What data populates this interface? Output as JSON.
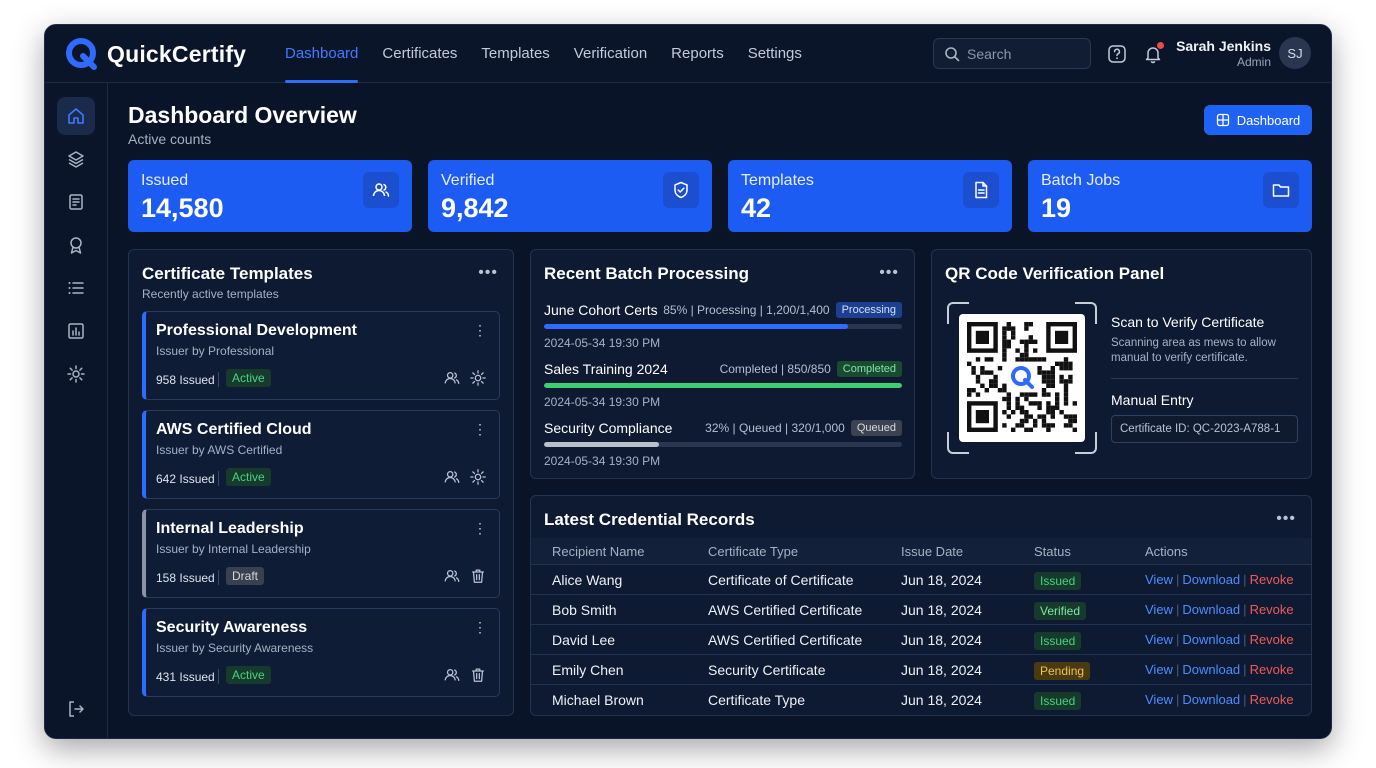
{
  "app": {
    "name": "QuickCertify"
  },
  "nav": {
    "items": [
      {
        "label": "Dashboard",
        "active": true
      },
      {
        "label": "Certificates"
      },
      {
        "label": "Templates"
      },
      {
        "label": "Verification"
      },
      {
        "label": "Reports"
      },
      {
        "label": "Settings"
      }
    ]
  },
  "search": {
    "placeholder": "Search"
  },
  "user": {
    "name": "Sarah Jenkins",
    "role": "Admin",
    "initials": "SJ"
  },
  "page": {
    "title": "Dashboard Overview",
    "subtitle": "Active counts",
    "button_label": "Dashboard"
  },
  "stats": [
    {
      "label": "Issued",
      "value": "14,580",
      "icon": "users-icon"
    },
    {
      "label": "Verified",
      "value": "9,842",
      "icon": "shield-check-icon"
    },
    {
      "label": "Templates",
      "value": "42",
      "icon": "document-icon"
    },
    {
      "label": "Batch Jobs",
      "value": "19",
      "icon": "folder-icon"
    }
  ],
  "templates_panel": {
    "title": "Certificate Templates",
    "subtitle": "Recently active templates",
    "items": [
      {
        "name": "Professional Development",
        "issuer": "Issuer by Professional",
        "count": "958",
        "count_suffix": "Issued",
        "status": "Active",
        "action": "gear-icon"
      },
      {
        "name": "AWS Certified Cloud",
        "issuer": "Issuer by AWS Certified",
        "count": "642",
        "count_suffix": "Issued",
        "status": "Active",
        "action": "gear-icon"
      },
      {
        "name": "Internal Leadership",
        "issuer": "Issuer by Internal Leadership",
        "count": "158",
        "count_suffix": "Issued",
        "status": "Draft",
        "action": "trash-icon"
      },
      {
        "name": "Security Awareness",
        "issuer": "Issuer by Security Awareness",
        "count": "431",
        "count_suffix": "Issued",
        "status": "Active",
        "action": "trash-icon"
      }
    ]
  },
  "batch_panel": {
    "title": "Recent Batch Processing",
    "items": [
      {
        "name": "June Cohort Certs",
        "meta": "85% | Processing | 1,200/1,400",
        "status": "Processing",
        "progress": 0.85,
        "color": "#2f6bff",
        "time": "2024-05-34 19:30 PM"
      },
      {
        "name": "Sales Training 2024",
        "meta": "Completed | 850/850",
        "status": "Completed",
        "progress": 1.0,
        "color": "#3fcf73",
        "time": "2024-05-34 19:30 PM"
      },
      {
        "name": "Security Compliance",
        "meta": "32% | Queued | 320/1,000",
        "status": "Queued",
        "progress": 0.32,
        "color": "#b8c0cc",
        "time": "2024-05-34 19:30 PM"
      }
    ]
  },
  "qr_panel": {
    "title": "QR Code Verification Panel",
    "scan_title": "Scan to Verify Certificate",
    "scan_desc": "Scanning area as mews to allow manual to verify certificate.",
    "manual_label": "Manual Entry",
    "manual_value": "Certificate ID: QC-2023-A788-1"
  },
  "records_panel": {
    "title": "Latest Credential Records",
    "columns": [
      "Recipient Name",
      "Certificate Type",
      "Issue Date",
      "Status",
      "Actions"
    ],
    "actions": {
      "view": "View",
      "download": "Download",
      "revoke": "Revoke"
    },
    "rows": [
      {
        "name": "Alice Wang",
        "type": "Certificate of Certificate",
        "date": "Jun 18, 2024",
        "status": "Issued"
      },
      {
        "name": "Bob Smith",
        "type": "AWS Certified Certificate",
        "date": "Jun 18, 2024",
        "status": "Verified"
      },
      {
        "name": "David Lee",
        "type": "AWS Certified Certificate",
        "date": "Jun 18, 2024",
        "status": "Issued"
      },
      {
        "name": "Emily Chen",
        "type": "Security Certificate",
        "date": "Jun 18, 2024",
        "status": "Pending"
      },
      {
        "name": "Michael Brown",
        "type": "Certificate Type",
        "date": "Jun 18, 2024",
        "status": "Issued"
      }
    ]
  },
  "sidebar": {
    "items": [
      "home-icon",
      "layers-icon",
      "certificate-icon",
      "award-icon",
      "list-icon",
      "chart-icon",
      "settings-icon"
    ],
    "bottom": "logout-icon"
  }
}
